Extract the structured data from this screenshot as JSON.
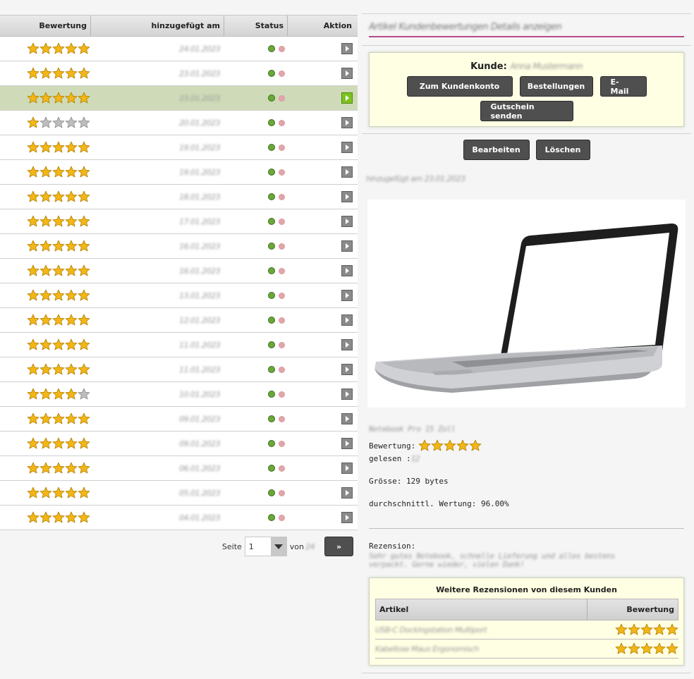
{
  "table": {
    "headers": {
      "rating": "Bewertung",
      "added": "hinzugefügt am",
      "status": "Status",
      "action": "Aktion"
    },
    "rows": [
      {
        "rating": 5,
        "date": "24.01.2023",
        "selected": false
      },
      {
        "rating": 5,
        "date": "23.01.2023",
        "selected": false
      },
      {
        "rating": 5,
        "date": "23.01.2023",
        "selected": true
      },
      {
        "rating": 1,
        "date": "20.01.2023",
        "selected": false
      },
      {
        "rating": 5,
        "date": "19.01.2023",
        "selected": false
      },
      {
        "rating": 5,
        "date": "19.01.2023",
        "selected": false
      },
      {
        "rating": 5,
        "date": "18.01.2023",
        "selected": false
      },
      {
        "rating": 5,
        "date": "17.01.2023",
        "selected": false
      },
      {
        "rating": 5,
        "date": "16.01.2023",
        "selected": false
      },
      {
        "rating": 5,
        "date": "16.01.2023",
        "selected": false
      },
      {
        "rating": 5,
        "date": "13.01.2023",
        "selected": false
      },
      {
        "rating": 5,
        "date": "12.01.2023",
        "selected": false
      },
      {
        "rating": 5,
        "date": "11.01.2023",
        "selected": false
      },
      {
        "rating": 5,
        "date": "11.01.2023",
        "selected": false
      },
      {
        "rating": 4,
        "date": "10.01.2023",
        "selected": false
      },
      {
        "rating": 5,
        "date": "09.01.2023",
        "selected": false
      },
      {
        "rating": 5,
        "date": "09.01.2023",
        "selected": false
      },
      {
        "rating": 5,
        "date": "06.01.2023",
        "selected": false
      },
      {
        "rating": 5,
        "date": "05.01.2023",
        "selected": false
      },
      {
        "rating": 5,
        "date": "04.01.2023",
        "selected": false
      }
    ]
  },
  "pager": {
    "page_label": "Seite",
    "page_value": "1",
    "of_label": "von",
    "of_value": "24",
    "next_label": "»"
  },
  "detail": {
    "title": "Artikel Kundenbewertungen Details anzeigen",
    "customer": {
      "label": "Kunde:",
      "name": "Anna Mustermann",
      "buttons": [
        "Zum Kundenkonto",
        "Bestellungen",
        "E-Mail",
        "Gutschein senden"
      ]
    },
    "edit_label": "Bearbeiten",
    "delete_label": "Löschen",
    "submeta": "hinzugefügt am 23.01.2023",
    "product_caption": "Notebook Pro 15 Zoll",
    "rating_label": "Bewertung:",
    "rating_value": 5,
    "read_label": "gelesen :",
    "read_value": "12",
    "size_text": "Grösse: 129 bytes",
    "avg_text": "durchschnittl. Wertung: 96.00%",
    "review_label": "Rezension:",
    "review_text": "Sehr gutes Notebook, schnelle Lieferung und alles bestens verpackt. Gerne wieder, vielen Dank!"
  },
  "more_reviews": {
    "title": "Weitere Rezensionen von diesem Kunden",
    "col_article": "Artikel",
    "col_rating": "Bewertung",
    "rows": [
      {
        "article": "USB-C Dockingstation Multiport",
        "rating": 5
      },
      {
        "article": "Kabellose Maus Ergonomisch",
        "rating": 5
      }
    ]
  },
  "colors": {
    "star_gold": "#f2b716",
    "star_grey": "#bdbdbd",
    "selected_row": "#cfdbb8",
    "accent_line": "#b44c86",
    "status_on": "#6aa83a",
    "status_off": "#e3a5ab"
  }
}
